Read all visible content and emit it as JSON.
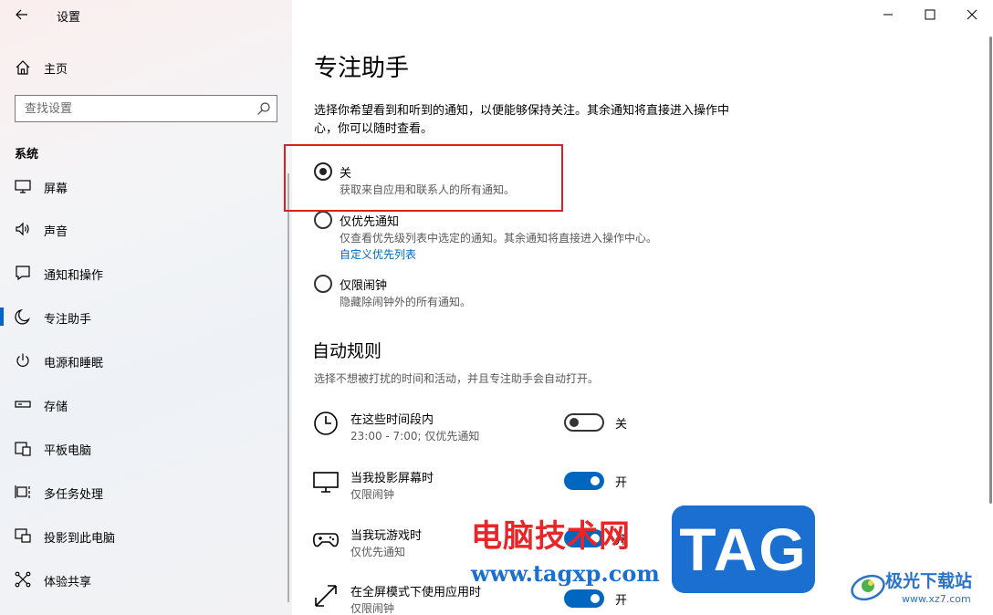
{
  "app": {
    "title": "设置"
  },
  "sidebar": {
    "home_label": "主页",
    "search_placeholder": "查找设置",
    "section_label": "系统",
    "items": [
      {
        "label": "屏幕",
        "icon": "display-icon"
      },
      {
        "label": "声音",
        "icon": "speaker-icon"
      },
      {
        "label": "通知和操作",
        "icon": "notification-icon"
      },
      {
        "label": "专注助手",
        "icon": "moon-icon",
        "active": true
      },
      {
        "label": "电源和睡眠",
        "icon": "power-icon"
      },
      {
        "label": "存储",
        "icon": "storage-icon"
      },
      {
        "label": "平板电脑",
        "icon": "tablet-icon"
      },
      {
        "label": "多任务处理",
        "icon": "multitask-icon"
      },
      {
        "label": "投影到此电脑",
        "icon": "project-icon"
      },
      {
        "label": "体验共享",
        "icon": "share-icon"
      }
    ]
  },
  "main": {
    "title": "专注助手",
    "description": "选择你希望看到和听到的通知，以便能够保持关注。其余通知将直接进入操作中心，你可以随时查看。",
    "options": [
      {
        "label": "关",
        "desc": "获取来自应用和联系人的所有通知。",
        "checked": true
      },
      {
        "label": "仅优先通知",
        "desc": "仅查看优先级列表中选定的通知。其余通知将直接进入操作中心。",
        "link": "自定义优先列表",
        "checked": false
      },
      {
        "label": "仅限闹钟",
        "desc": "隐藏除闹钟外的所有通知。",
        "checked": false
      }
    ],
    "auto_rules": {
      "title": "自动规则",
      "description": "选择不想被打扰的时间和活动，并且专注助手会自动打开。",
      "rules": [
        {
          "title": "在这些时间段内",
          "sub": "23:00 - 7:00; 仅优先通知",
          "state": "关",
          "on": false,
          "icon": "clock-icon"
        },
        {
          "title": "当我投影屏幕时",
          "sub": "仅限闹钟",
          "state": "开",
          "on": true,
          "icon": "monitor-icon"
        },
        {
          "title": "当我玩游戏时",
          "sub": "仅优先通知",
          "state": "开",
          "on": true,
          "icon": "gamepad-icon"
        },
        {
          "title": "在全屏模式下使用应用时",
          "sub": "仅限闹钟",
          "state": "开",
          "on": true,
          "icon": "fullscreen-icon"
        }
      ]
    }
  },
  "watermarks": {
    "cn_text": "电脑技术网",
    "url": "www.tagxp.com",
    "tag": "TAG",
    "site_name": "极光下载站",
    "site_url": "www.xz7.com"
  },
  "colors": {
    "accent": "#0067c0",
    "highlight": "#e02020"
  }
}
